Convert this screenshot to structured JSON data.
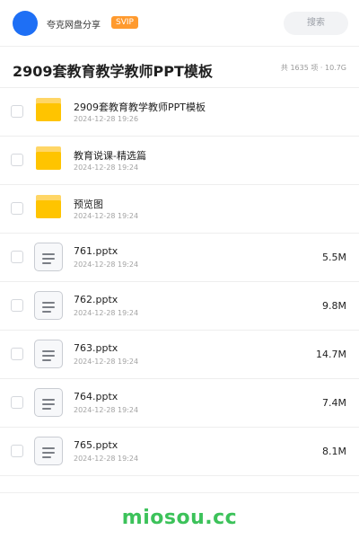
{
  "header": {
    "user_name": "夸克网盘分享",
    "badge": "SVIP",
    "search_placeholder": "搜索"
  },
  "share": {
    "title": "2909套教育教学教师PPT模板",
    "summary": "共 1635 项 · 10.7G"
  },
  "items": [
    {
      "type": "folder",
      "name": "2909套教育教学教师PPT模板",
      "date": "2024-12-28 19:26",
      "size": ""
    },
    {
      "type": "folder",
      "name": "教育说课-精选篇",
      "date": "2024-12-28 19:24",
      "size": ""
    },
    {
      "type": "folder",
      "name": "预览图",
      "date": "2024-12-28 19:24",
      "size": ""
    },
    {
      "type": "file",
      "name": "761.pptx",
      "date": "2024-12-28 19:24",
      "size": "5.5M"
    },
    {
      "type": "file",
      "name": "762.pptx",
      "date": "2024-12-28 19:24",
      "size": "9.8M"
    },
    {
      "type": "file",
      "name": "763.pptx",
      "date": "2024-12-28 19:24",
      "size": "14.7M"
    },
    {
      "type": "file",
      "name": "764.pptx",
      "date": "2024-12-28 19:24",
      "size": "7.4M"
    },
    {
      "type": "file",
      "name": "765.pptx",
      "date": "2024-12-28 19:24",
      "size": "8.1M"
    }
  ],
  "footer": {
    "watermark": "miosou.cc"
  },
  "colors": {
    "accent": "#1e6ff5",
    "badge": "#ff9a2e",
    "folder": "#ffc400",
    "watermark": "#3cc25a"
  }
}
